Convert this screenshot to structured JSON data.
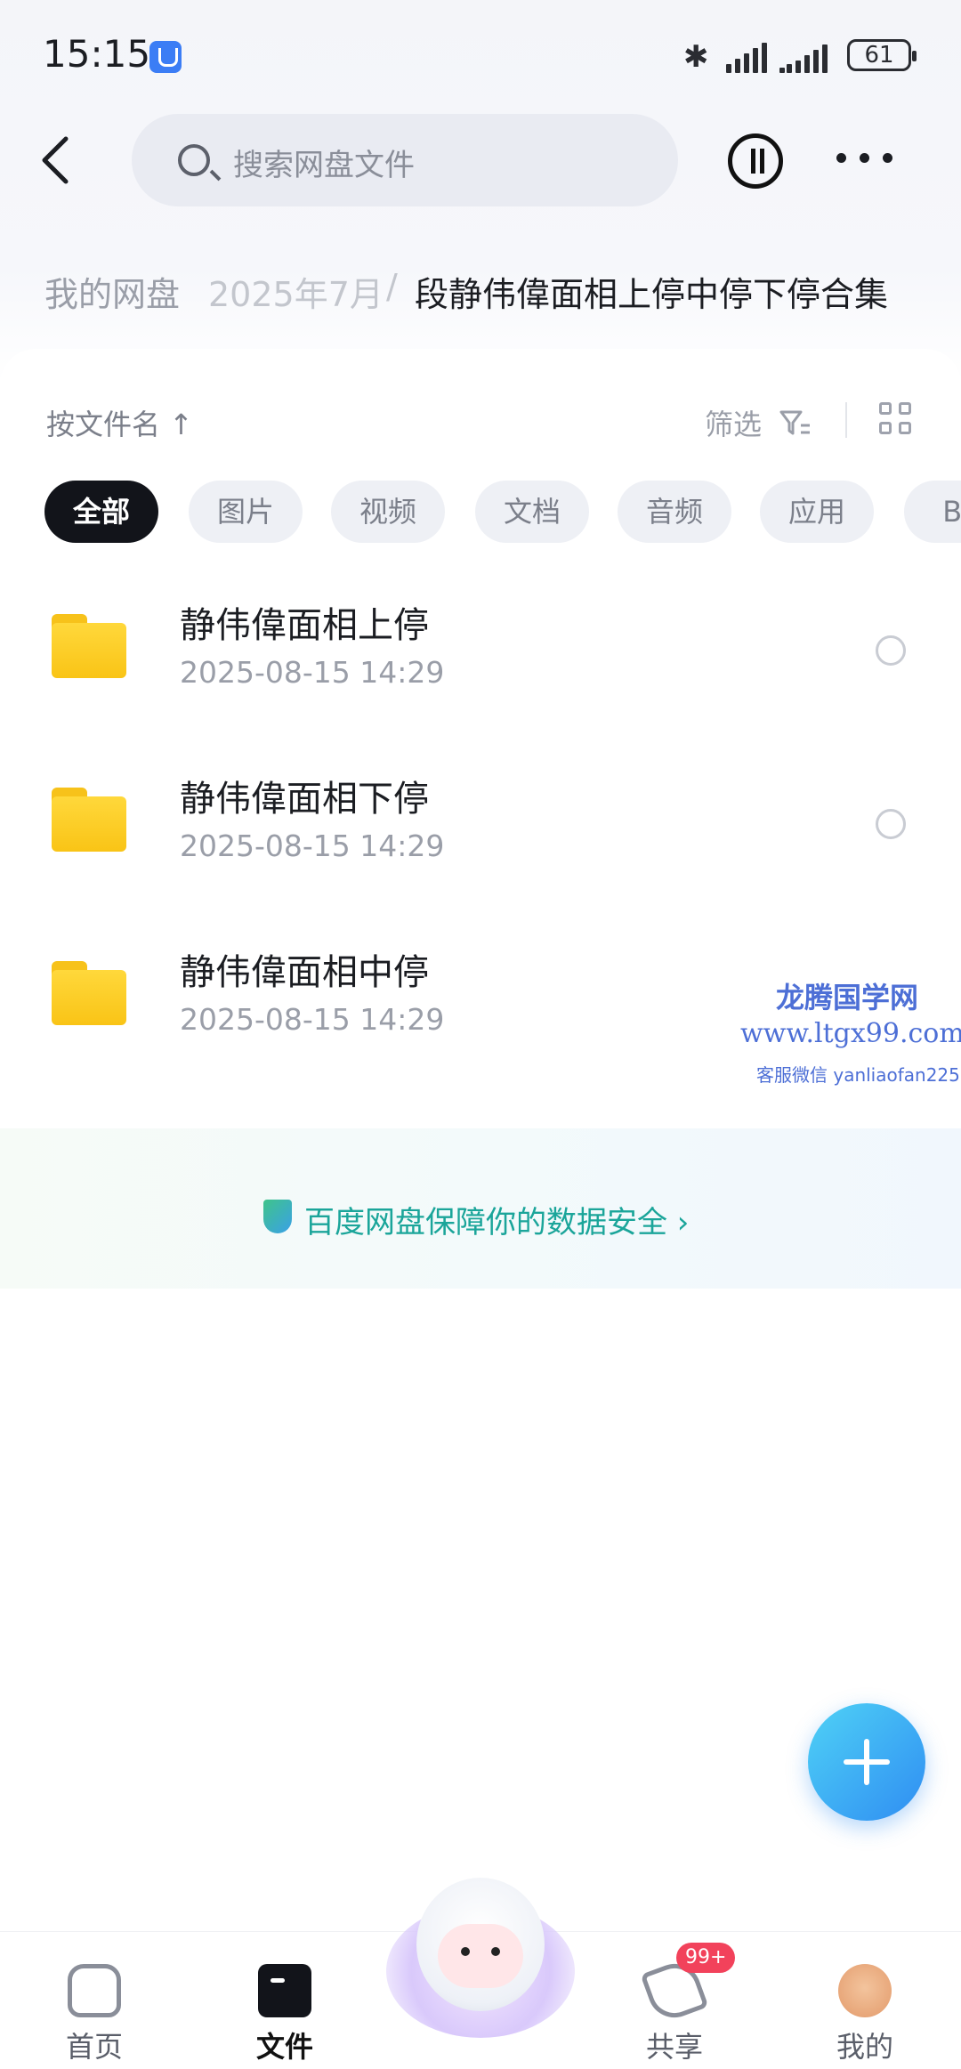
{
  "status_bar": {
    "time": "15:15",
    "battery": "61"
  },
  "header": {
    "search_placeholder": "搜索网盘文件"
  },
  "breadcrumb": {
    "root": "我的网盘",
    "middle": "2025年7月",
    "separator": "/",
    "current": "段静伟偉面相上停中停下停合集"
  },
  "toolbar": {
    "sort_label": "按文件名 ↑",
    "filter_label": "筛选"
  },
  "chips": [
    "全部",
    "图片",
    "视频",
    "文档",
    "音频",
    "应用",
    "BT"
  ],
  "files": [
    {
      "name": "静伟偉面相上停",
      "date": "2025-08-15  14:29"
    },
    {
      "name": "静伟偉面相下停",
      "date": "2025-08-15  14:29"
    },
    {
      "name": "静伟偉面相中停",
      "date": "2025-08-15  14:29"
    }
  ],
  "watermark": {
    "line1": "龙腾国学网",
    "line2": "www.ltgx99.com",
    "line3": "客服微信 yanliaofan225"
  },
  "safety_notice": "百度网盘保障你的数据安全 ›",
  "nav": {
    "home": "首页",
    "files": "文件",
    "share": "共享",
    "share_badge": "99+",
    "me": "我的"
  },
  "colors": {
    "accent": "#2f8df2",
    "safety": "#1ba59a",
    "badge": "#f2425b",
    "folder": "#f9c416"
  }
}
